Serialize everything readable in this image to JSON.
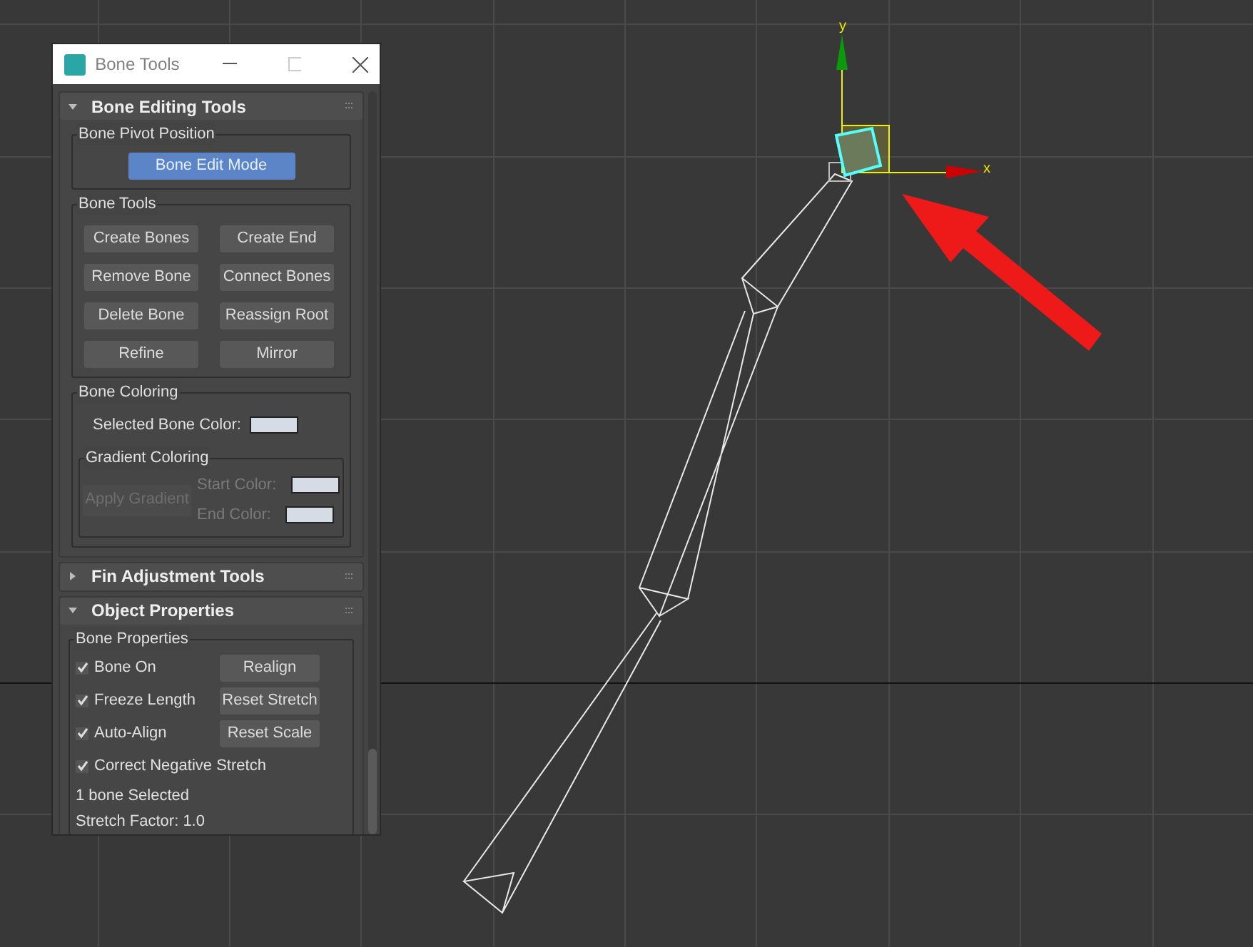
{
  "viewport": {
    "axis_labels": [
      "y",
      "x"
    ]
  },
  "window": {
    "title": "Bone Tools"
  },
  "rollouts": [
    {
      "title": "Bone Editing Tools",
      "expanded": true,
      "kind": "editing",
      "groups": [
        {
          "title": "Bone Pivot Position",
          "buttons": [
            {
              "label": "Bone Edit Mode",
              "selected": true
            }
          ]
        },
        {
          "title": "Bone Tools",
          "buttons": [
            {
              "label": "Create Bones",
              "selected": false
            },
            {
              "label": "Create End",
              "selected": false
            },
            {
              "label": "Remove Bone",
              "selected": false
            },
            {
              "label": "Connect Bones",
              "selected": false
            },
            {
              "label": "Delete Bone",
              "selected": false
            },
            {
              "label": "Reassign Root",
              "selected": false
            },
            {
              "label": "Refine",
              "selected": false
            },
            {
              "label": "Mirror",
              "selected": false
            }
          ]
        }
      ],
      "coloring": {
        "title": "Bone Coloring",
        "selected_label": "Selected Bone Color:",
        "gradient": {
          "title": "Gradient Coloring",
          "button": "Apply Gradient",
          "disabled": true,
          "start_label": "Start Color:",
          "end_label": "End Color:"
        }
      }
    },
    {
      "title": "Fin Adjustment Tools",
      "expanded": false,
      "kind": "fin"
    },
    {
      "title": "Object Properties",
      "expanded": true,
      "kind": "properties",
      "group": {
        "title": "Bone Properties",
        "rows": [
          {
            "label": "Bone On",
            "checked": true,
            "button": "Realign"
          },
          {
            "label": "Freeze Length",
            "checked": true,
            "button": "Reset Stretch"
          },
          {
            "label": "Auto-Align",
            "checked": true,
            "button": "Reset Scale"
          },
          {
            "label": "Correct Negative Stretch",
            "checked": true
          }
        ],
        "status": "1 bone Selected",
        "stretch": "Stretch Factor: 1.0"
      }
    }
  ]
}
